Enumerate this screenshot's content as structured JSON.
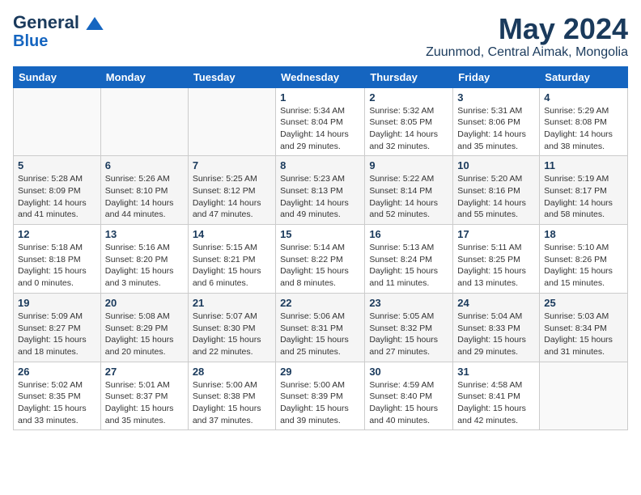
{
  "header": {
    "logo_line1": "General",
    "logo_line2": "Blue",
    "title": "May 2024",
    "subtitle": "Zuunmod, Central Aimak, Mongolia"
  },
  "days_of_week": [
    "Sunday",
    "Monday",
    "Tuesday",
    "Wednesday",
    "Thursday",
    "Friday",
    "Saturday"
  ],
  "weeks": [
    [
      {
        "num": "",
        "info": ""
      },
      {
        "num": "",
        "info": ""
      },
      {
        "num": "",
        "info": ""
      },
      {
        "num": "1",
        "info": "Sunrise: 5:34 AM\nSunset: 8:04 PM\nDaylight: 14 hours\nand 29 minutes."
      },
      {
        "num": "2",
        "info": "Sunrise: 5:32 AM\nSunset: 8:05 PM\nDaylight: 14 hours\nand 32 minutes."
      },
      {
        "num": "3",
        "info": "Sunrise: 5:31 AM\nSunset: 8:06 PM\nDaylight: 14 hours\nand 35 minutes."
      },
      {
        "num": "4",
        "info": "Sunrise: 5:29 AM\nSunset: 8:08 PM\nDaylight: 14 hours\nand 38 minutes."
      }
    ],
    [
      {
        "num": "5",
        "info": "Sunrise: 5:28 AM\nSunset: 8:09 PM\nDaylight: 14 hours\nand 41 minutes."
      },
      {
        "num": "6",
        "info": "Sunrise: 5:26 AM\nSunset: 8:10 PM\nDaylight: 14 hours\nand 44 minutes."
      },
      {
        "num": "7",
        "info": "Sunrise: 5:25 AM\nSunset: 8:12 PM\nDaylight: 14 hours\nand 47 minutes."
      },
      {
        "num": "8",
        "info": "Sunrise: 5:23 AM\nSunset: 8:13 PM\nDaylight: 14 hours\nand 49 minutes."
      },
      {
        "num": "9",
        "info": "Sunrise: 5:22 AM\nSunset: 8:14 PM\nDaylight: 14 hours\nand 52 minutes."
      },
      {
        "num": "10",
        "info": "Sunrise: 5:20 AM\nSunset: 8:16 PM\nDaylight: 14 hours\nand 55 minutes."
      },
      {
        "num": "11",
        "info": "Sunrise: 5:19 AM\nSunset: 8:17 PM\nDaylight: 14 hours\nand 58 minutes."
      }
    ],
    [
      {
        "num": "12",
        "info": "Sunrise: 5:18 AM\nSunset: 8:18 PM\nDaylight: 15 hours\nand 0 minutes."
      },
      {
        "num": "13",
        "info": "Sunrise: 5:16 AM\nSunset: 8:20 PM\nDaylight: 15 hours\nand 3 minutes."
      },
      {
        "num": "14",
        "info": "Sunrise: 5:15 AM\nSunset: 8:21 PM\nDaylight: 15 hours\nand 6 minutes."
      },
      {
        "num": "15",
        "info": "Sunrise: 5:14 AM\nSunset: 8:22 PM\nDaylight: 15 hours\nand 8 minutes."
      },
      {
        "num": "16",
        "info": "Sunrise: 5:13 AM\nSunset: 8:24 PM\nDaylight: 15 hours\nand 11 minutes."
      },
      {
        "num": "17",
        "info": "Sunrise: 5:11 AM\nSunset: 8:25 PM\nDaylight: 15 hours\nand 13 minutes."
      },
      {
        "num": "18",
        "info": "Sunrise: 5:10 AM\nSunset: 8:26 PM\nDaylight: 15 hours\nand 15 minutes."
      }
    ],
    [
      {
        "num": "19",
        "info": "Sunrise: 5:09 AM\nSunset: 8:27 PM\nDaylight: 15 hours\nand 18 minutes."
      },
      {
        "num": "20",
        "info": "Sunrise: 5:08 AM\nSunset: 8:29 PM\nDaylight: 15 hours\nand 20 minutes."
      },
      {
        "num": "21",
        "info": "Sunrise: 5:07 AM\nSunset: 8:30 PM\nDaylight: 15 hours\nand 22 minutes."
      },
      {
        "num": "22",
        "info": "Sunrise: 5:06 AM\nSunset: 8:31 PM\nDaylight: 15 hours\nand 25 minutes."
      },
      {
        "num": "23",
        "info": "Sunrise: 5:05 AM\nSunset: 8:32 PM\nDaylight: 15 hours\nand 27 minutes."
      },
      {
        "num": "24",
        "info": "Sunrise: 5:04 AM\nSunset: 8:33 PM\nDaylight: 15 hours\nand 29 minutes."
      },
      {
        "num": "25",
        "info": "Sunrise: 5:03 AM\nSunset: 8:34 PM\nDaylight: 15 hours\nand 31 minutes."
      }
    ],
    [
      {
        "num": "26",
        "info": "Sunrise: 5:02 AM\nSunset: 8:35 PM\nDaylight: 15 hours\nand 33 minutes."
      },
      {
        "num": "27",
        "info": "Sunrise: 5:01 AM\nSunset: 8:37 PM\nDaylight: 15 hours\nand 35 minutes."
      },
      {
        "num": "28",
        "info": "Sunrise: 5:00 AM\nSunset: 8:38 PM\nDaylight: 15 hours\nand 37 minutes."
      },
      {
        "num": "29",
        "info": "Sunrise: 5:00 AM\nSunset: 8:39 PM\nDaylight: 15 hours\nand 39 minutes."
      },
      {
        "num": "30",
        "info": "Sunrise: 4:59 AM\nSunset: 8:40 PM\nDaylight: 15 hours\nand 40 minutes."
      },
      {
        "num": "31",
        "info": "Sunrise: 4:58 AM\nSunset: 8:41 PM\nDaylight: 15 hours\nand 42 minutes."
      },
      {
        "num": "",
        "info": ""
      }
    ]
  ]
}
